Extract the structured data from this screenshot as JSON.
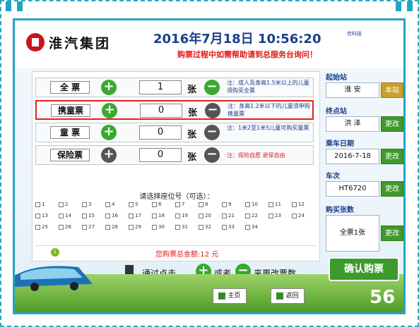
{
  "header": {
    "company": "淮汽集团",
    "datetime": "2016年7月18日 10:56:20",
    "notice": "购票过程中如需帮助请到总服务台询问！",
    "corp_name": "信科技"
  },
  "tickets": [
    {
      "label": "全  票",
      "qty": "1",
      "unit": "张",
      "note": "注：成人及身高1.5米以上的儿童须购买全票",
      "note_color": "#1d3a8a"
    },
    {
      "label": "携童票",
      "qty": "0",
      "unit": "张",
      "note": "注：身高1.2米以下的儿童须申购携童票",
      "note_color": "#1d3a8a"
    },
    {
      "label": "童  票",
      "qty": "0",
      "unit": "张",
      "note": "注：1米2至1米5儿童可购买童票",
      "note_color": "#1d3a8a"
    },
    {
      "label": "保险票",
      "qty": "0",
      "unit": "张",
      "note": "注：保险自愿 退保自由",
      "note_color": "#e01818"
    }
  ],
  "seat_title": "请选择座位号（可选）：",
  "seats": [
    "1",
    "2",
    "3",
    "4",
    "5",
    "6",
    "7",
    "8",
    "9",
    "10",
    "11",
    "12",
    "13",
    "14",
    "15",
    "16",
    "17",
    "18",
    "19",
    "20",
    "21",
    "22",
    "23",
    "24",
    "25",
    "26",
    "27",
    "28",
    "29",
    "30",
    "31",
    "32",
    "33",
    "34"
  ],
  "total_text": "您购票总金额:12 元",
  "hint": {
    "prefix": "通过点击",
    "middle": "或者",
    "suffix": "来更改票数"
  },
  "right_panel": {
    "start_label": "起始站",
    "start_value": "淮 安",
    "start_btn": "本站",
    "end_label": "终点站",
    "end_value": "洪 泽",
    "end_btn": "更改",
    "date_label": "乘车日期",
    "date_value": "2016-7-18",
    "date_btn": "更改",
    "train_label": "车次",
    "train_value": "HT6720",
    "train_btn": "更改",
    "count_label": "购买张数",
    "count_value": "全票1张",
    "count_btn": "更改"
  },
  "confirm_label": "确认购票",
  "nav": {
    "home": "主页",
    "back": "返回"
  },
  "page_number": "56"
}
